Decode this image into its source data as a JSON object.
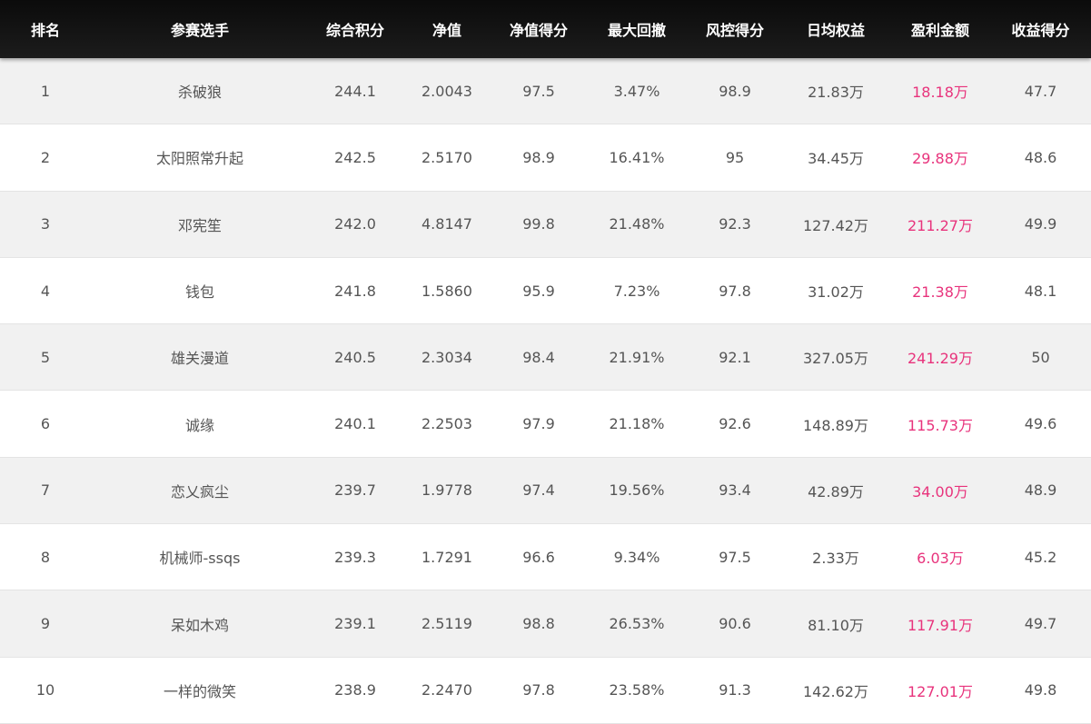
{
  "colors": {
    "header_bg": "#111111",
    "header_text": "#ffffff",
    "row_odd": "#f1f1f1",
    "row_even": "#ffffff",
    "text": "#555555",
    "profit": "#e8337c"
  },
  "header": [
    "排名",
    "参赛选手",
    "综合积分",
    "净值",
    "净值得分",
    "最大回撤",
    "风控得分",
    "日均权益",
    "盈利金额",
    "收益得分"
  ],
  "rows": [
    [
      "1",
      "杀破狼",
      "244.1",
      "2.0043",
      "97.5",
      "3.47%",
      "98.9",
      "21.83万",
      "18.18万",
      "47.7"
    ],
    [
      "2",
      "太阳照常升起",
      "242.5",
      "2.5170",
      "98.9",
      "16.41%",
      "95",
      "34.45万",
      "29.88万",
      "48.6"
    ],
    [
      "3",
      "邓宪笙",
      "242.0",
      "4.8147",
      "99.8",
      "21.48%",
      "92.3",
      "127.42万",
      "211.27万",
      "49.9"
    ],
    [
      "4",
      "钱包",
      "241.8",
      "1.5860",
      "95.9",
      "7.23%",
      "97.8",
      "31.02万",
      "21.38万",
      "48.1"
    ],
    [
      "5",
      "雄关漫道",
      "240.5",
      "2.3034",
      "98.4",
      "21.91%",
      "92.1",
      "327.05万",
      "241.29万",
      "50"
    ],
    [
      "6",
      "诚缘",
      "240.1",
      "2.2503",
      "97.9",
      "21.18%",
      "92.6",
      "148.89万",
      "115.73万",
      "49.6"
    ],
    [
      "7",
      "恋乂疯尘",
      "239.7",
      "1.9778",
      "97.4",
      "19.56%",
      "93.4",
      "42.89万",
      "34.00万",
      "48.9"
    ],
    [
      "8",
      "机械师-ssqs",
      "239.3",
      "1.7291",
      "96.6",
      "9.34%",
      "97.5",
      "2.33万",
      "6.03万",
      "45.2"
    ],
    [
      "9",
      "呆如木鸡",
      "239.1",
      "2.5119",
      "98.8",
      "26.53%",
      "90.6",
      "81.10万",
      "117.91万",
      "49.7"
    ],
    [
      "10",
      "一样的微笑",
      "238.9",
      "2.2470",
      "97.8",
      "23.58%",
      "91.3",
      "142.62万",
      "127.01万",
      "49.8"
    ]
  ]
}
